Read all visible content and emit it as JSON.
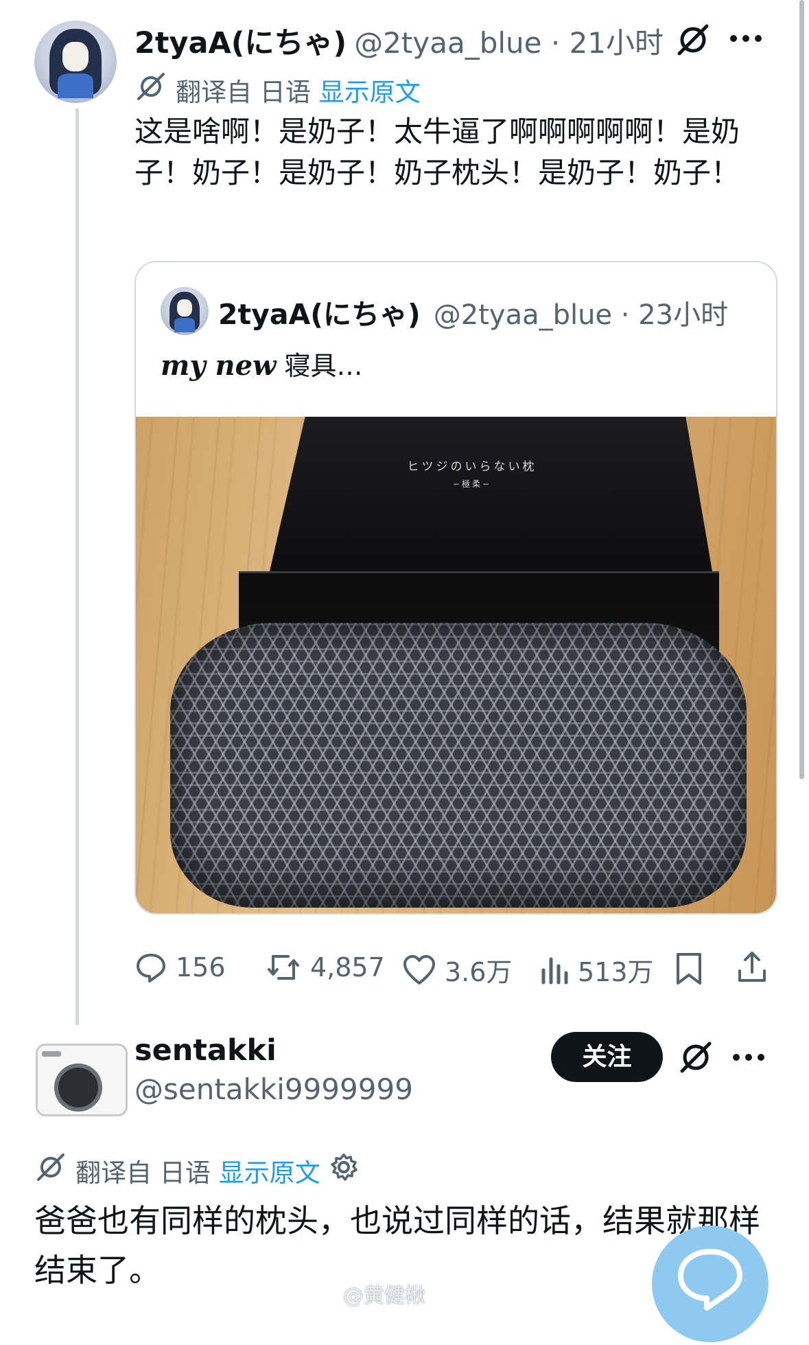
{
  "main_tweet": {
    "display_name": "2tyaA(にちゃ)",
    "handle": "@2tyaa_blue",
    "time": " · 21小时",
    "translate_prefix": "翻译自 日语",
    "show_original": "显示原文",
    "text": "这是啥啊！是奶子！太牛逼了啊啊啊啊啊！是奶子！奶子！是奶子！奶子枕头！是奶子！奶子！"
  },
  "quoted_tweet": {
    "display_name": "2tyaA(にちゃ)",
    "handle": "@2tyaa_blue",
    "time": " · 23小时",
    "text_fancy": "my new",
    "text_rest": " 寝具…",
    "photo_box_text": "ヒツジのいらない枕",
    "photo_box_subtext": "−極柔−"
  },
  "actions": {
    "replies": "156",
    "retweets": "4,857",
    "likes": "3.6万",
    "views": "513万"
  },
  "reply_tweet": {
    "display_name": "sentakki",
    "handle": "@sentakki9999999",
    "follow_label": "关注",
    "translate_prefix": "翻译自 日语",
    "show_original": "显示原文",
    "text": "爸爸也有同样的枕头，也说过同样的话，结果就那样结束了。"
  },
  "watermark": "@黄健楸",
  "icons": {
    "grok": "grok-icon",
    "more": "more-icon",
    "translate": "translate-icon",
    "settings": "gear-icon",
    "reply": "reply-icon",
    "retweet": "retweet-icon",
    "like": "heart-icon",
    "views": "views-icon",
    "bookmark": "bookmark-icon",
    "share": "share-icon"
  },
  "colors": {
    "text": "#0f1419",
    "muted": "#536471",
    "link": "#1d9bf0",
    "border": "#cfd9de",
    "fab": "#8ec9f2"
  }
}
